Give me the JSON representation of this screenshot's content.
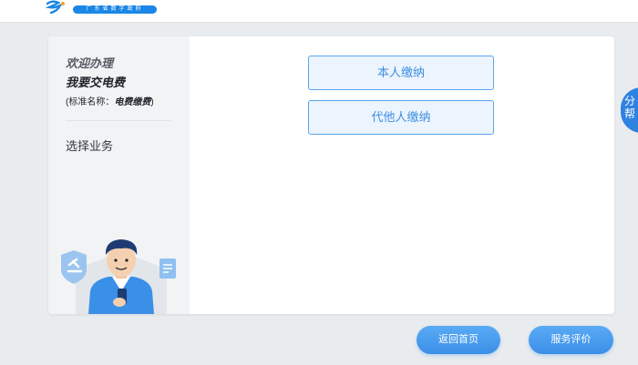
{
  "header": {
    "logo_banner": "广东省数字政府"
  },
  "sidebar": {
    "welcome": "欢迎办理",
    "service_title": "我要交电费",
    "standard_name_label": "(标准名称：",
    "standard_name_value": "电费缴费",
    "standard_name_close": ")",
    "choose_business": "选择业务"
  },
  "options": {
    "self_pay": "本人缴纳",
    "pay_for_others": "代他人缴纳"
  },
  "side_tab": {
    "text": "分帮"
  },
  "footer": {
    "home_button": "返回首页",
    "rate_button": "服务评价"
  },
  "colors": {
    "accent": "#3d8fe3",
    "button_fill": "#ecf4fd",
    "background": "#e9ecef"
  }
}
